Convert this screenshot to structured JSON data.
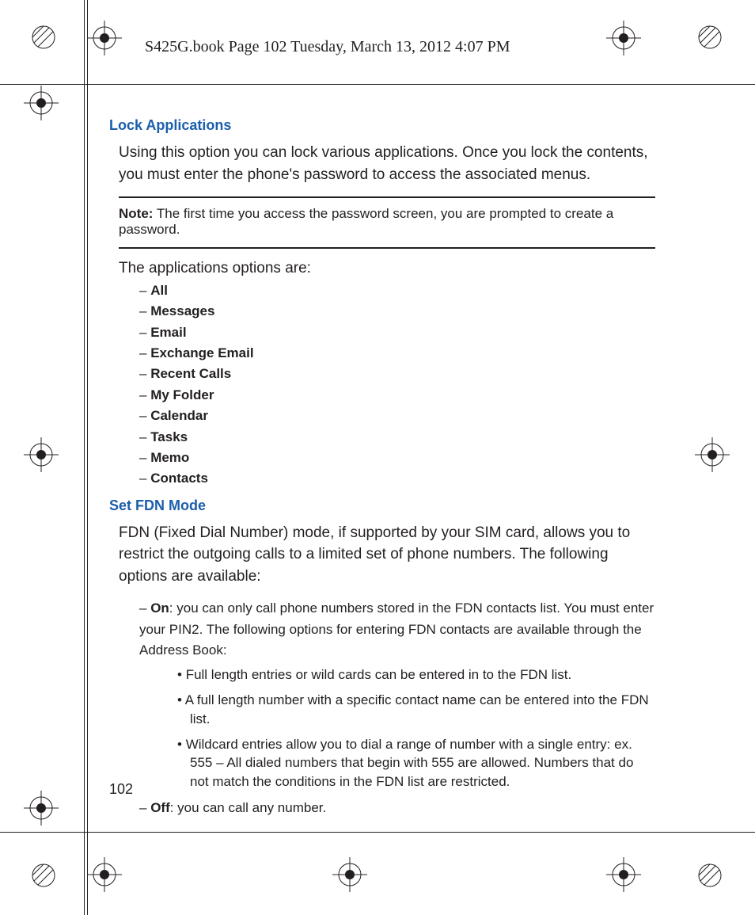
{
  "header": "S425G.book  Page 102  Tuesday, March 13, 2012  4:07 PM",
  "section1": {
    "title": "Lock Applications",
    "para": "Using this option you can lock various applications. Once you lock the contents, you must enter the phone's password to access the associated menus.",
    "noteLabel": "Note:",
    "noteText": " The first time you access the password screen, you are prompted to create a password.",
    "optionsIntro": "The applications options are:",
    "options": [
      "All",
      "Messages",
      "Email",
      "Exchange Email",
      "Recent Calls",
      "My Folder",
      "Calendar",
      "Tasks",
      "Memo",
      "Contacts"
    ]
  },
  "section2": {
    "title": "Set FDN Mode",
    "para": "FDN (Fixed Dial Number) mode, if supported by your SIM card, allows you to restrict the outgoing calls to a limited set of phone numbers. The following options are available:",
    "onLabel": "On",
    "onText": ": you can only call phone numbers stored in the FDN contacts list. You must enter your PIN2. The following options for entering FDN contacts are available through the Address Book:",
    "bullets": [
      "Full length entries or wild cards can be entered in to the FDN list.",
      "A full length number with a specific contact name can be entered into the FDN list.",
      "Wildcard entries allow you to dial a range of number with a single entry: ex. 555 – All dialed numbers that begin with 555 are allowed. Numbers that do not match the conditions in the FDN list are restricted."
    ],
    "offLabel": "Off",
    "offText": ": you can call any number."
  },
  "pageNumber": "102"
}
